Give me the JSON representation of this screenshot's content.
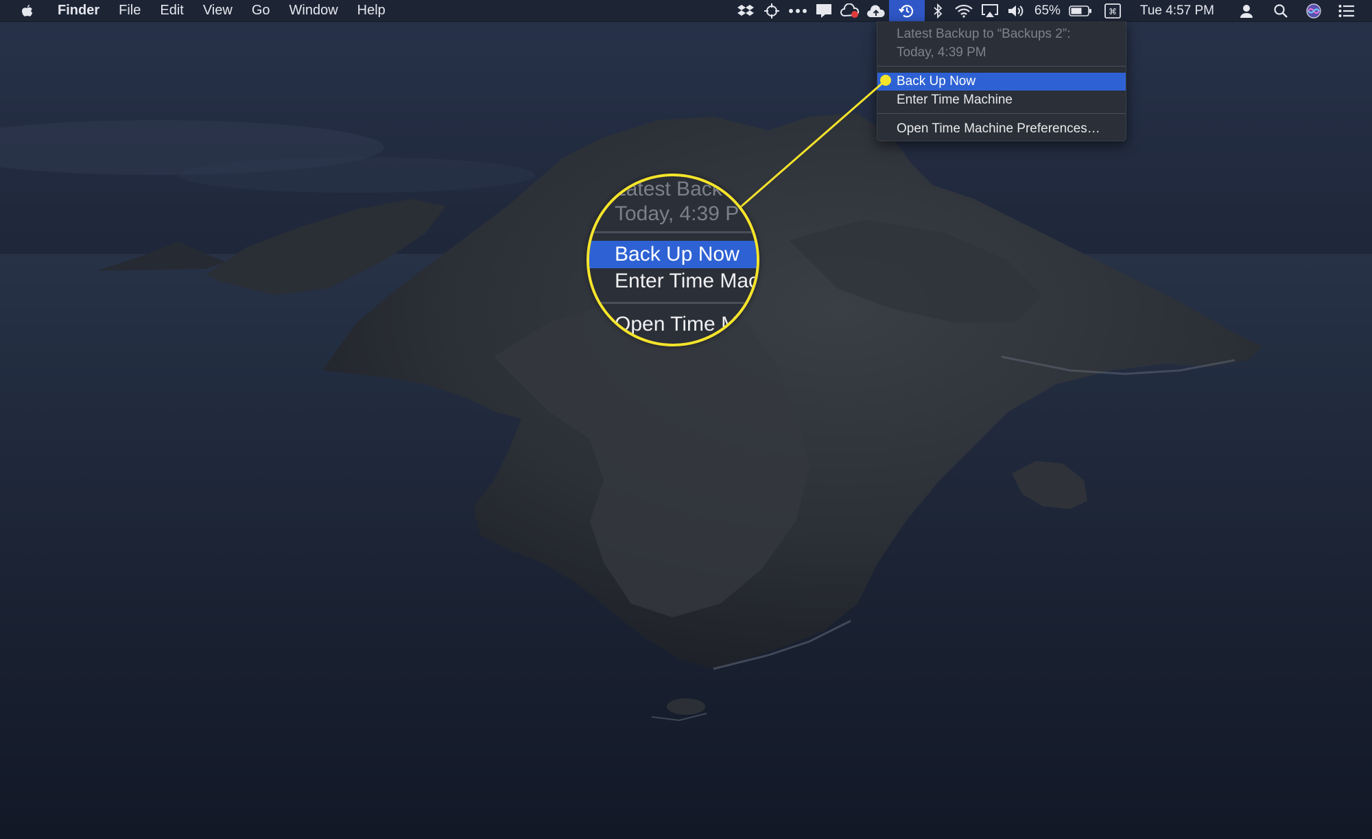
{
  "menubar": {
    "apple_icon": "apple-logo-icon",
    "app_name": "Finder",
    "menus": [
      "File",
      "Edit",
      "View",
      "Go",
      "Window",
      "Help"
    ],
    "status_icons": [
      "dropbox-icon",
      "crosshair-icon",
      "dots-icon",
      "notification-icon",
      "cloud-sync-icon",
      "upload-cloud-icon",
      "time-machine-icon",
      "bluetooth-icon",
      "wifi-icon",
      "airplay-icon",
      "volume-icon"
    ],
    "battery_percent": "65%",
    "battery_icon": "battery-icon",
    "keyboard_icon": "command-key-icon",
    "clock": "Tue 4:57 PM",
    "user_icon": "user-icon",
    "spotlight_icon": "search-icon",
    "siri_icon": "siri-icon",
    "notification_center_icon": "list-icon"
  },
  "time_machine_menu": {
    "info_line1": "Latest Backup to “Backups 2”:",
    "info_line2": "Today, 4:39 PM",
    "items": [
      "Back Up Now",
      "Enter Time Machine",
      "Open Time Machine Preferences…"
    ],
    "highlighted_item": "Back Up Now"
  },
  "magnifier": {
    "info_line1": "Latest Back",
    "info_line2": "Today, 4:39 P",
    "item1": "Back Up Now",
    "item2": "Enter Time Mac",
    "item3": "Open Time M"
  },
  "colors": {
    "callout": "#f5e42b",
    "highlight": "#2e62d4",
    "menubar": "#1d2535"
  }
}
